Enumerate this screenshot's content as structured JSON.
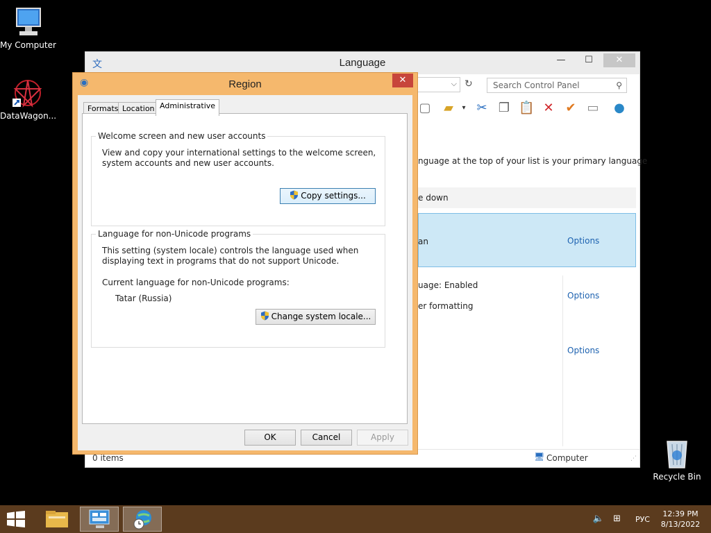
{
  "desktop": {
    "icons": [
      {
        "label": "My Computer"
      },
      {
        "label": "DataWagon..."
      },
      {
        "label": "Recycle Bin"
      }
    ]
  },
  "language_window": {
    "title": "Language",
    "search_placeholder": "Search Control Panel",
    "main": {
      "line1": "nguage at the top of your list is your primary language",
      "line2": "e down",
      "line3": "an",
      "line4": "uage: Enabled",
      "line5": "er formatting"
    },
    "options": [
      "Options",
      "Options",
      "Options"
    ],
    "status": {
      "items": "0 items",
      "computer": "Computer"
    }
  },
  "region_dialog": {
    "title": "Region",
    "tabs": [
      "Formats",
      "Location",
      "Administrative"
    ],
    "active_tab": "Administrative",
    "group1": {
      "label": "Welcome screen and new user accounts",
      "text": "View and copy your international settings to the welcome screen, system accounts and new user accounts.",
      "button": "Copy settings..."
    },
    "group2": {
      "label": "Language for non-Unicode programs",
      "text": "This setting (system locale) controls the language used when displaying text in programs that do not support Unicode.",
      "current_label": "Current language for non-Unicode programs:",
      "current_value": "Tatar (Russia)",
      "button": "Change system locale..."
    },
    "buttons": {
      "ok": "OK",
      "cancel": "Cancel",
      "apply": "Apply"
    }
  },
  "taskbar": {
    "language": "РУС",
    "time": "12:39 PM",
    "date": "8/13/2022"
  },
  "colors": {
    "dialog_frame": "#f5b86d",
    "taskbar": "#5b3b1e",
    "link": "#1d62b0",
    "selection": "#cde8f6"
  }
}
